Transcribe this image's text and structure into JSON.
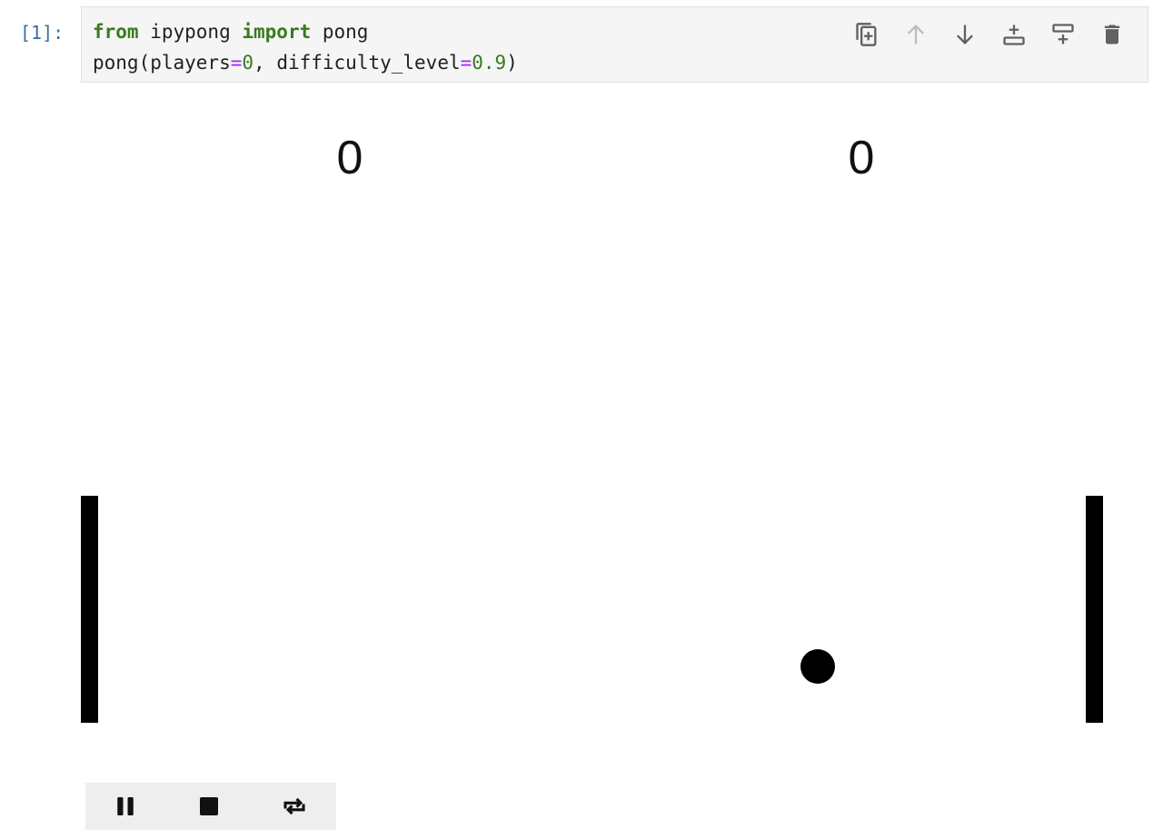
{
  "cell": {
    "prompt": "[1]:",
    "code": {
      "line1": {
        "kw_from": "from",
        "module": " ipypong ",
        "kw_import": "import",
        "name": " pong"
      },
      "line2": {
        "call_open": "pong(players",
        "eq1": "=",
        "val1": "0",
        "mid": ", difficulty_level",
        "eq2": "=",
        "val2": "0.9",
        "call_close": ")"
      }
    },
    "toolbar": {
      "icons": [
        "duplicate-icon",
        "move-up-icon",
        "move-down-icon",
        "insert-above-icon",
        "insert-below-icon",
        "delete-icon"
      ],
      "colors": {
        "active": "#616161",
        "disabled": "#bdbdbd"
      }
    }
  },
  "game": {
    "score_left": "0",
    "score_right": "0",
    "colors": {
      "paddle": "#000000",
      "ball": "#000000",
      "background": "#ffffff"
    }
  },
  "controls": {
    "icons": [
      "pause-icon",
      "stop-icon",
      "repeat-icon"
    ]
  }
}
